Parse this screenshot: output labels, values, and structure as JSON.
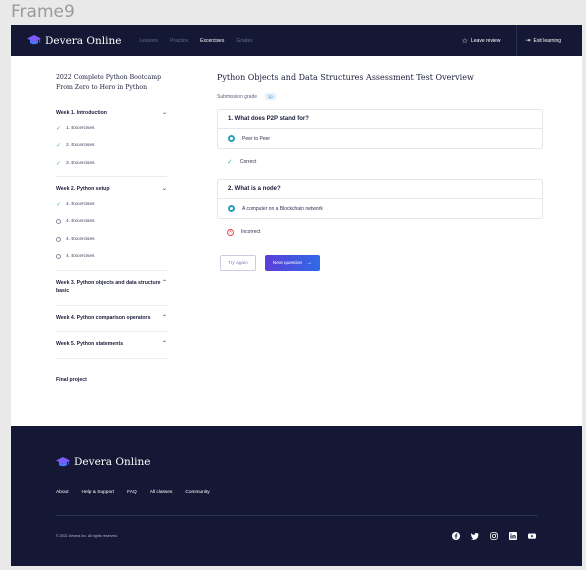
{
  "frame_label": "Frame9",
  "brand": "Devera Online",
  "nav": [
    {
      "label": "Lessons",
      "active": false
    },
    {
      "label": "Practice",
      "active": false
    },
    {
      "label": "Excercises",
      "active": true
    },
    {
      "label": "Grades",
      "active": false
    }
  ],
  "header": {
    "leave_review": "Leave review",
    "exit_learning": "Exit learning"
  },
  "sidebar": {
    "course_title": "2022 Complete Python Bootcamp From Zero to Hero in Python",
    "weeks": [
      {
        "title": "Week 1. Introduction",
        "expanded": true,
        "items": [
          {
            "label": "1. Excercises",
            "status": "done"
          },
          {
            "label": "2. Excercises",
            "status": "done"
          },
          {
            "label": "3. Excercises",
            "status": "done"
          }
        ]
      },
      {
        "title": "Week 2. Python setup",
        "expanded": true,
        "items": [
          {
            "label": "4. Excercises",
            "status": "done"
          },
          {
            "label": "4. Excercises",
            "status": "todo"
          },
          {
            "label": "4. Excercises",
            "status": "todo"
          },
          {
            "label": "4. Excercises",
            "status": "todo"
          }
        ]
      },
      {
        "title": "Week 3. Python objects and data structure basic",
        "expanded": false,
        "items": []
      },
      {
        "title": "Week 4. Python comparison operators",
        "expanded": false,
        "items": []
      },
      {
        "title": "Week 5. Python statements",
        "expanded": false,
        "items": []
      }
    ],
    "final": "Final project"
  },
  "main": {
    "title": "Python Objects and Data Structures Assessment Test Overview",
    "submission_label": "Submission grade",
    "grade_badge": "1p",
    "questions": [
      {
        "question": "1. What does P2P stand for?",
        "answer": "Peer to Peer",
        "result": "Correct",
        "correct": true
      },
      {
        "question": "2. What is a node?",
        "answer": "A computer on a Blockchain network",
        "result": "Incorrect",
        "correct": false
      }
    ],
    "try_again": "Try again",
    "next_question": "Next question"
  },
  "footer": {
    "links": [
      "About",
      "Help & Support",
      "FAQ",
      "All classes",
      "Community"
    ],
    "copyright": "© 2021 Devera Inc. All rights reserved.",
    "social": [
      "facebook-icon",
      "twitter-icon",
      "instagram-icon",
      "linkedin-icon",
      "youtube-icon"
    ]
  },
  "colors": {
    "navy": "#141834",
    "accent": "#2f6ae6",
    "check": "#3fbf8f",
    "radio": "#2aa0b8",
    "error": "#e24c4c"
  }
}
